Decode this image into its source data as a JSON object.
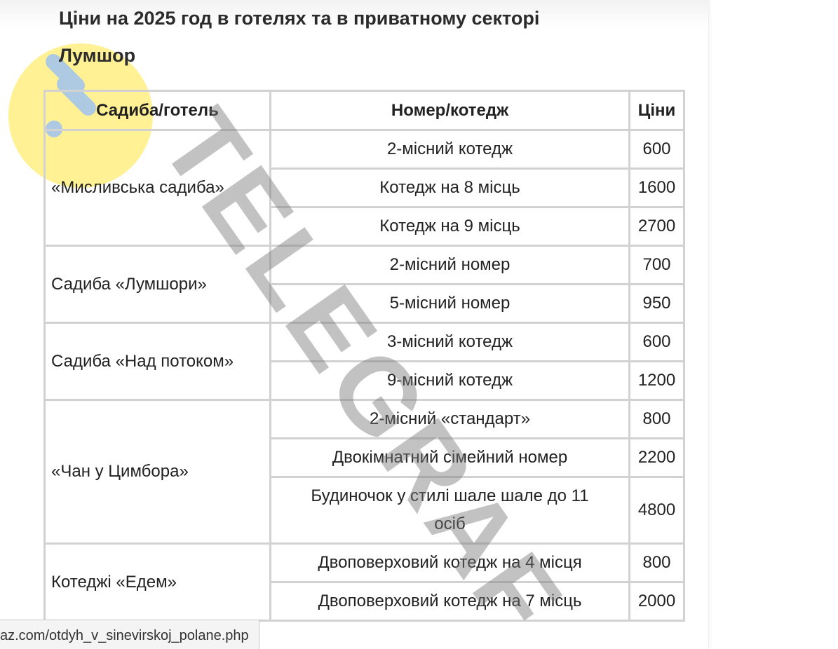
{
  "heading": {
    "line1": "Ціни на 2025 год в готелях та в приватному секторі",
    "line2": "Лумшор"
  },
  "table": {
    "headers": [
      "Садиба/готель",
      "Номер/котедж",
      "Ціни"
    ],
    "groups": [
      {
        "place": "«Мисливська садиба»",
        "rows": [
          {
            "room": "2-місний котедж",
            "price": "600"
          },
          {
            "room": "Котедж на 8 місць",
            "price": "1600"
          },
          {
            "room": "Котедж на 9 місць",
            "price": "2700"
          }
        ]
      },
      {
        "place": "Садиба «Лумшори»",
        "rows": [
          {
            "room": "2-місний номер",
            "price": "700"
          },
          {
            "room": "5-місний номер",
            "price": "950"
          }
        ]
      },
      {
        "place": "Садиба «Над потоком»",
        "rows": [
          {
            "room": "3-місний котедж",
            "price": "600"
          },
          {
            "room": "9-місний котедж",
            "price": "1200"
          }
        ]
      },
      {
        "place": "«Чан у Цимбора»",
        "rows": [
          {
            "room": "2-місний «стандарт»",
            "price": "800"
          },
          {
            "room": "Двокімнатний сімейний номер",
            "price": "2200"
          },
          {
            "room": "Будиночок у стилі шале шале до 11 осіб",
            "price": "4800"
          }
        ]
      },
      {
        "place": "Котеджі «Едем»",
        "rows": [
          {
            "room": "Двоповерховий котедж на 4 місця",
            "price": "800"
          },
          {
            "room": "Двоповерховий котедж на 7 місць",
            "price": "2000"
          }
        ]
      }
    ]
  },
  "watermark": {
    "text": "TELEGRAF",
    "logo_color": "#FFE63C",
    "logo_mark_color": "#9FC3F0"
  },
  "status_bar": {
    "url": "az.com/otdyh_v_sinevirskoj_polane.php"
  }
}
